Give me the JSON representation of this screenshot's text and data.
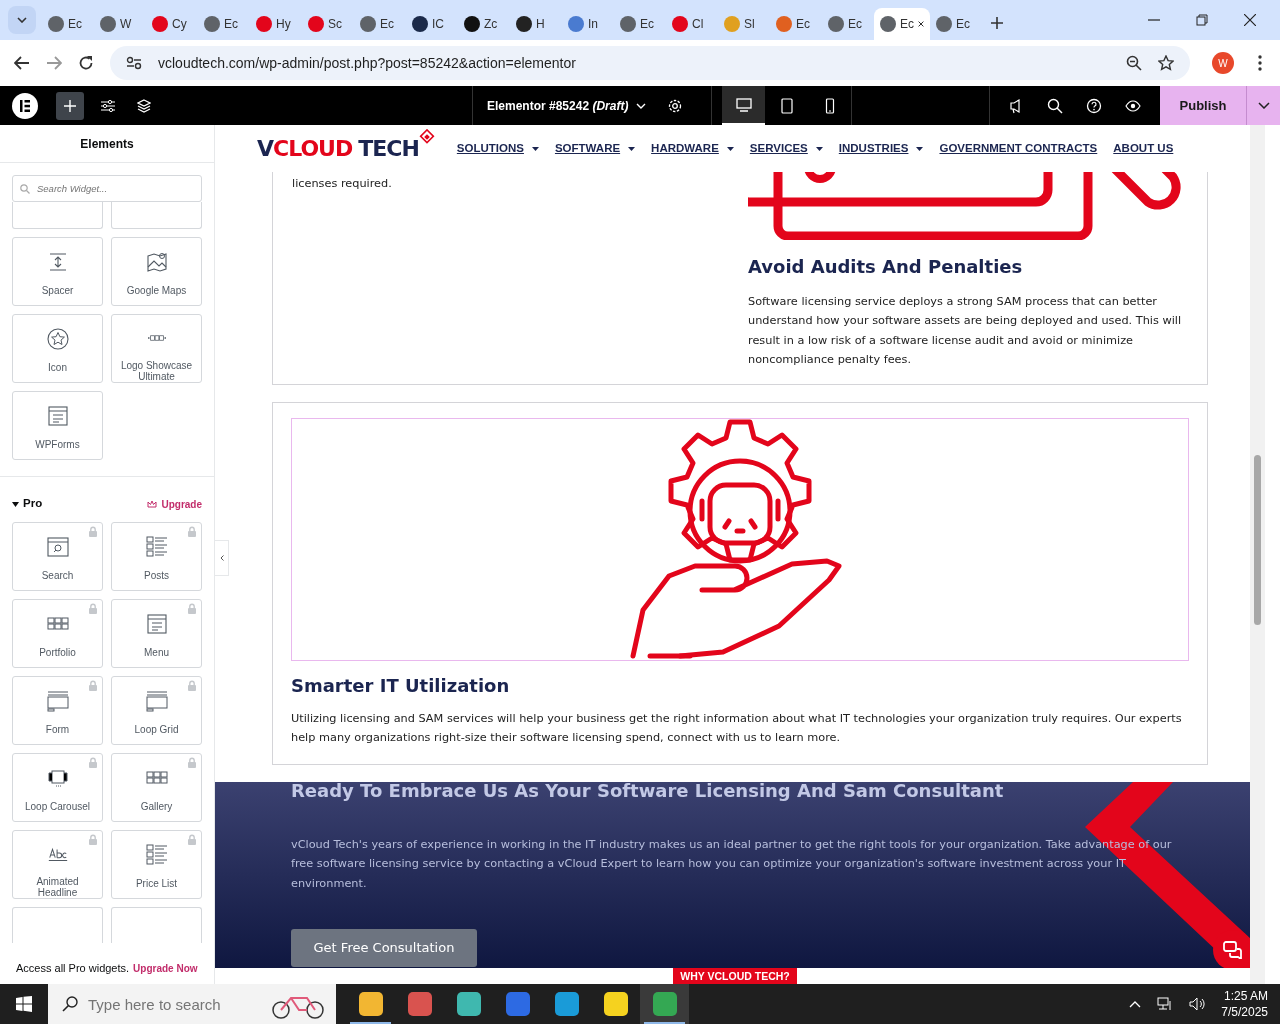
{
  "browser": {
    "tabs": [
      {
        "label": "Ec",
        "selected": false,
        "color": "#5f6368"
      },
      {
        "label": "W",
        "selected": false,
        "color": "#5f6368"
      },
      {
        "label": "Cy",
        "selected": false,
        "color": "#e3051b"
      },
      {
        "label": "Ec",
        "selected": false,
        "color": "#5f6368"
      },
      {
        "label": "Hy",
        "selected": false,
        "color": "#e3051b"
      },
      {
        "label": "Sc",
        "selected": false,
        "color": "#e3051b"
      },
      {
        "label": "Ec",
        "selected": false,
        "color": "#5f6368"
      },
      {
        "label": "IC",
        "selected": false,
        "color": "#1b2a4a"
      },
      {
        "label": "Zc",
        "selected": false,
        "color": "#111111"
      },
      {
        "label": "H",
        "selected": false,
        "color": "#222222"
      },
      {
        "label": "In",
        "selected": false,
        "color": "#4a7bd0"
      },
      {
        "label": "Ec",
        "selected": false,
        "color": "#5f6368"
      },
      {
        "label": "Cl",
        "selected": false,
        "color": "#e3051b"
      },
      {
        "label": "Sl",
        "selected": false,
        "color": "#e0a020"
      },
      {
        "label": "Ec",
        "selected": false,
        "color": "#e06020"
      },
      {
        "label": "Ec",
        "selected": false,
        "color": "#5f6368"
      },
      {
        "label": "Ec",
        "selected": true,
        "color": "#5f6368"
      },
      {
        "label": "Ec",
        "selected": false,
        "color": "#5f6368"
      }
    ],
    "url": "vcloudtech.com/wp-admin/post.php?post=85242&action=elementor",
    "profile": "W"
  },
  "editor_bar": {
    "title": "Elementor #85242",
    "status": "(Draft)",
    "publish": "Publish",
    "devices": [
      {
        "kind": "desktop",
        "selected": true
      },
      {
        "kind": "tablet",
        "selected": false
      },
      {
        "kind": "mobile",
        "selected": false
      }
    ]
  },
  "panel": {
    "title": "Elements",
    "search_placeholder": "Search Widget...",
    "widgets": [
      {
        "label": "Spacer",
        "kind": "spacer",
        "locked": false
      },
      {
        "label": "Google Maps",
        "kind": "map",
        "locked": false
      },
      {
        "label": "Icon",
        "kind": "star",
        "locked": false
      },
      {
        "label": "Logo Showcase Ultimate",
        "kind": "dots",
        "locked": false
      },
      {
        "label": "WPForms",
        "kind": "form",
        "locked": false
      }
    ],
    "pro_title": "Pro",
    "upgrade": "Upgrade",
    "pro_widgets": [
      {
        "label": "Search",
        "kind": "search",
        "locked": true
      },
      {
        "label": "Posts",
        "kind": "list",
        "locked": true
      },
      {
        "label": "Portfolio",
        "kind": "grid",
        "locked": true
      },
      {
        "label": "Menu",
        "kind": "form",
        "locked": true
      },
      {
        "label": "Form",
        "kind": "window",
        "locked": true
      },
      {
        "label": "Loop Grid",
        "kind": "window",
        "locked": true
      },
      {
        "label": "Loop Carousel",
        "kind": "carousel",
        "locked": true
      },
      {
        "label": "Gallery",
        "kind": "grid",
        "locked": true
      },
      {
        "label": "Animated Headline",
        "kind": "text",
        "locked": true
      },
      {
        "label": "Price List",
        "kind": "list",
        "locked": true
      }
    ],
    "promo_text": "Access all Pro widgets.",
    "promo_link": "Upgrade Now"
  },
  "site": {
    "logo": [
      "V",
      "CLOUD",
      "TECH"
    ],
    "nav": [
      {
        "label": "SOLUTIONS",
        "dropdown": true
      },
      {
        "label": "SOFTWARE",
        "dropdown": true
      },
      {
        "label": "HARDWARE",
        "dropdown": true
      },
      {
        "label": "SERVICES",
        "dropdown": true
      },
      {
        "label": "INDUSTRIES",
        "dropdown": true
      },
      {
        "label": "GOVERNMENT CONTRACTS",
        "dropdown": false
      },
      {
        "label": "ABOUT US",
        "dropdown": false
      }
    ],
    "card_1": {
      "left_text": "licenses required.",
      "title": "Avoid Audits And Penalties",
      "text": "Software licensing service deploys a strong SAM process that can better understand how your software assets are being deployed and used. This will result in a low risk of a software license audit and avoid or minimize noncompliance penalty fees."
    },
    "card_2": {
      "title": "Smarter IT Utilization",
      "text": "Utilizing licensing and SAM services will help your business get the right information about what IT technologies your organization truly requires. Our experts help many organizations right-size their software licensing spend, connect with us to learn more."
    },
    "banner": {
      "title": "Ready To Embrace Us As Your Software Licensing And Sam Consultant",
      "text": "vCloud Tech's years of experience in working in the IT industry makes us an ideal partner to get the right tools for your organization. Take advantage of our free software licensing service by contacting a vCloud Expert to learn how you can optimize your organization's software investment across your IT environment.",
      "button": "Get Free Consultation"
    },
    "bottom_tab": "WHY VCLOUD TECH?"
  },
  "taskbar": {
    "search_placeholder": "Type here to search",
    "time": "1:25 AM",
    "date": "7/5/2025",
    "apps": [
      {
        "color": "#f2b632",
        "running": true,
        "selected": false
      },
      {
        "color": "#d9534f",
        "running": false,
        "selected": false
      },
      {
        "color": "#3fb8af",
        "running": false,
        "selected": false
      },
      {
        "color": "#2d6ae3",
        "running": false,
        "selected": false
      },
      {
        "color": "#1a9bd8",
        "running": false,
        "selected": false
      },
      {
        "color": "#f5d21f",
        "running": false,
        "selected": false
      },
      {
        "color": "#34a853",
        "running": true,
        "selected": true
      }
    ]
  }
}
